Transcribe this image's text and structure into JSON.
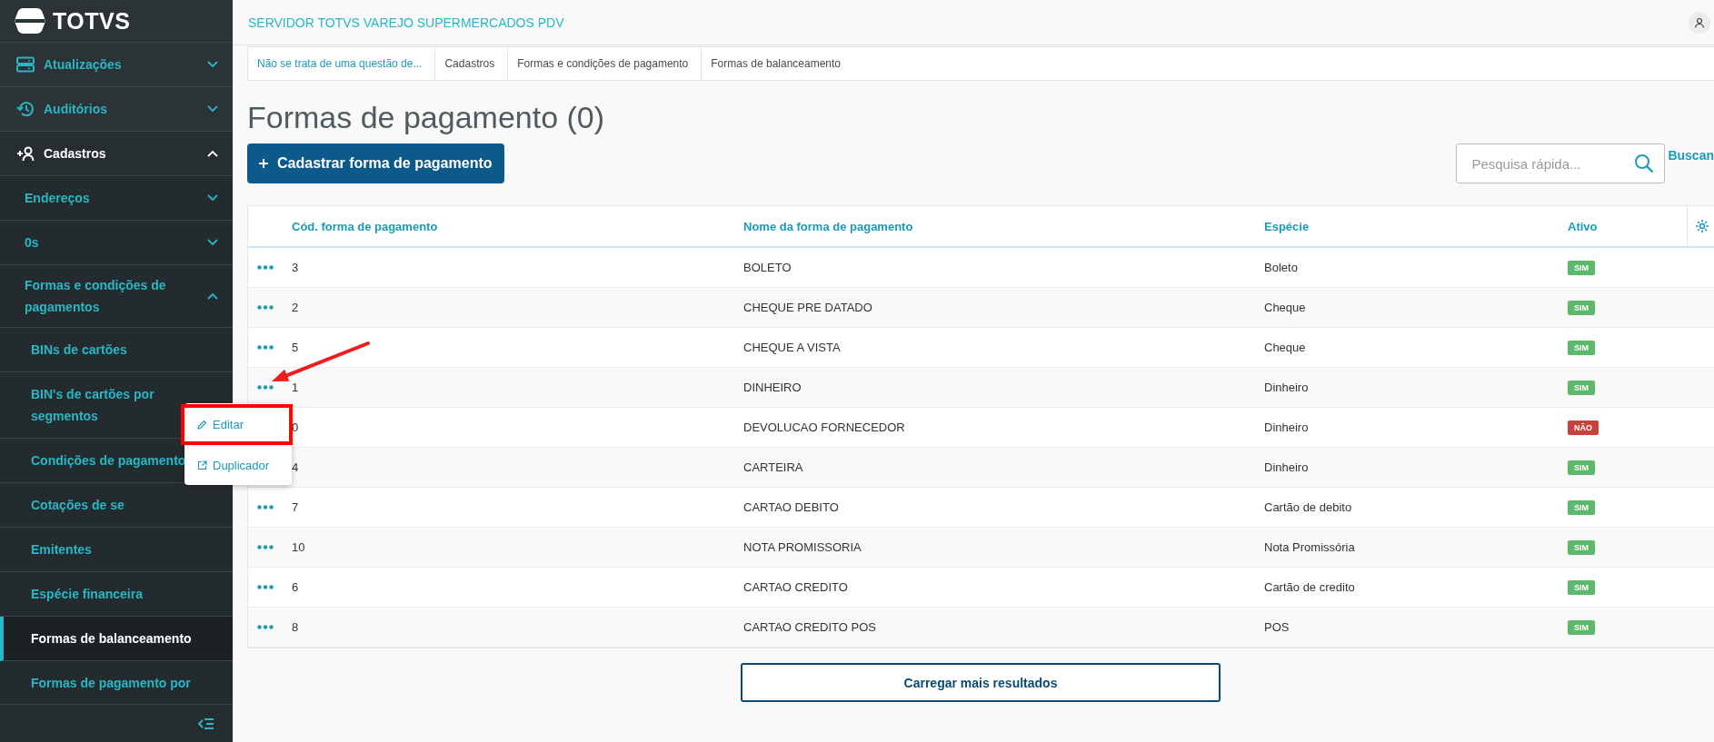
{
  "brand": "TOTVS",
  "sidebar": {
    "items": [
      {
        "label": "Atualizações",
        "expanded": false
      },
      {
        "label": "Auditórios",
        "expanded": false
      },
      {
        "label": "Cadastros",
        "expanded": true,
        "children": [
          {
            "label": "Endereços",
            "expanded": false
          },
          {
            "label": "0s",
            "expanded": false
          },
          {
            "label": "Formas e condições de pagamentos",
            "expanded": true,
            "children": [
              {
                "label": "BINs de cartões",
                "selected": false
              },
              {
                "label": "BIN's de cartões por segmentos",
                "selected": false
              },
              {
                "label": "Condições de pagamento",
                "selected": false
              },
              {
                "label": "Cotações de se",
                "selected": false
              },
              {
                "label": "Emitentes",
                "selected": false
              },
              {
                "label": "Espécie financeira",
                "selected": false
              },
              {
                "label": "Formas de balanceamento",
                "selected": true
              },
              {
                "label": "Formas de pagamento por",
                "selected": false
              }
            ]
          }
        ]
      }
    ]
  },
  "header": {
    "title": "SERVIDOR TOTVS VAREJO SUPERMERCADOS PDV"
  },
  "breadcrumb": [
    "Não se trata de uma questão de...",
    "Cadastros",
    "Formas e condições de pagamento",
    "Formas de balanceamento"
  ],
  "page_title": "Formas de pagamento (0)",
  "new_button": "Cadastrar forma de pagamento",
  "search": {
    "placeholder": "Pesquisa rápida..."
  },
  "advanced_link": "Buscan",
  "table": {
    "columns": [
      "Cód. forma de pagamento",
      "Nome da forma de pagamento",
      "Espécie",
      "Ativo"
    ],
    "rows": [
      {
        "code": "3",
        "name": "BOLETO",
        "species": "Boleto",
        "status": "SIM",
        "active": true,
        "menu_open": false
      },
      {
        "code": "2",
        "name": "CHEQUE PRE DATADO",
        "species": "Cheque",
        "status": "SIM",
        "active": true,
        "menu_open": false
      },
      {
        "code": "5",
        "name": "CHEQUE A VISTA",
        "species": "Cheque",
        "status": "SIM",
        "active": true,
        "menu_open": false
      },
      {
        "code": "1",
        "name": "DINHEIRO",
        "species": "Dinheiro",
        "status": "SIM",
        "active": true,
        "menu_open": true
      },
      {
        "code": "0",
        "name": "DEVOLUCAO FORNECEDOR",
        "species": "Dinheiro",
        "status": "NÃO",
        "active": false,
        "menu_open": false
      },
      {
        "code": "4",
        "name": "CARTEIRA",
        "species": "Dinheiro",
        "status": "SIM",
        "active": true,
        "menu_open": false
      },
      {
        "code": "7",
        "name": "CARTAO DEBITO",
        "species": "Cartão de debito",
        "status": "SIM",
        "active": true,
        "menu_open": false
      },
      {
        "code": "10",
        "name": "NOTA PROMISSORIA",
        "species": "Nota Promissória",
        "status": "SIM",
        "active": true,
        "menu_open": false
      },
      {
        "code": "6",
        "name": "CARTAO CREDITO",
        "species": "Cartão de credito",
        "status": "SIM",
        "active": true,
        "menu_open": false
      },
      {
        "code": "8",
        "name": "CARTAO CREDITO POS",
        "species": "POS",
        "status": "SIM",
        "active": true,
        "menu_open": false
      }
    ]
  },
  "row_menu": [
    "Editar",
    "Duplicador"
  ],
  "load_more": "Carregar mais resultados"
}
